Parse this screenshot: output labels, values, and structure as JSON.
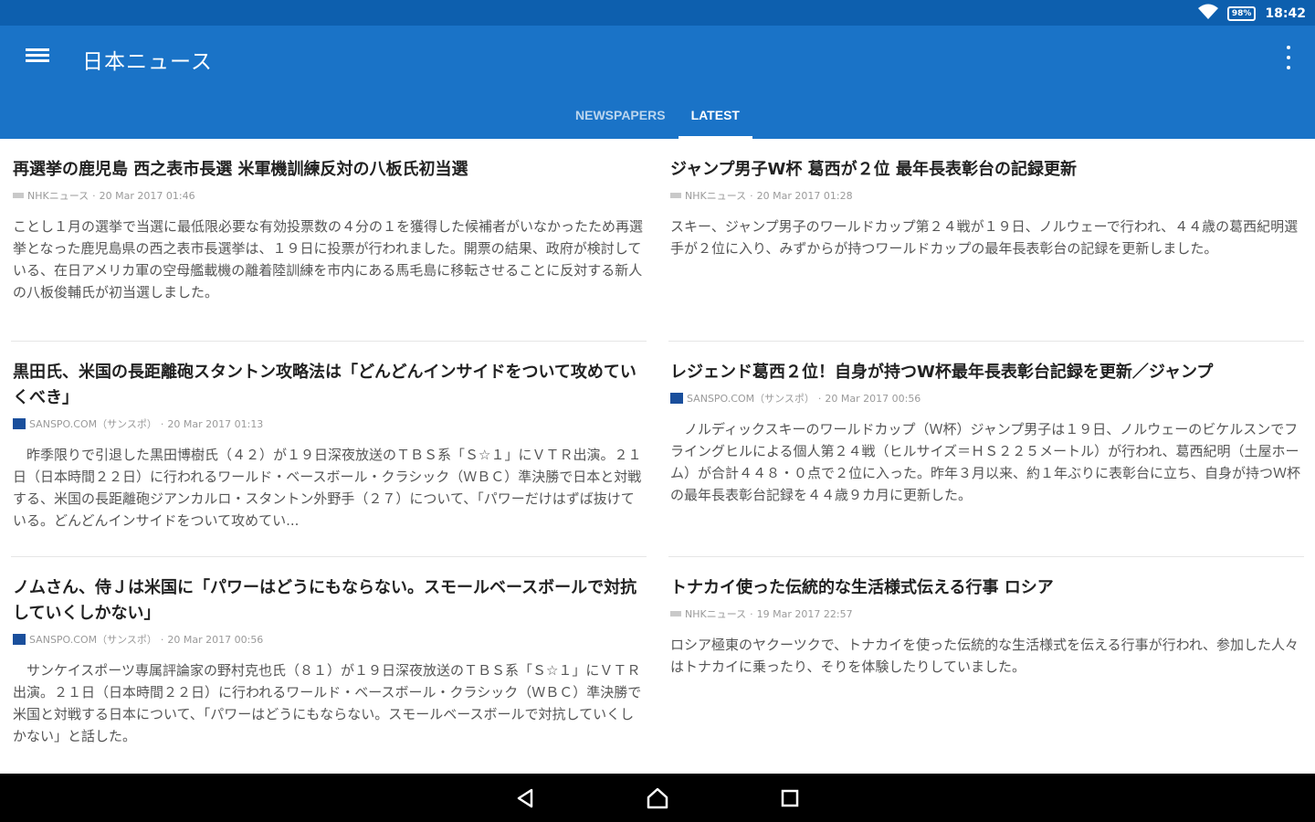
{
  "status_bar": {
    "battery": "98%",
    "time": "18:42"
  },
  "appbar": {
    "title": "日本ニュース"
  },
  "tabs": [
    {
      "label": "NEWSPAPERS",
      "active": false
    },
    {
      "label": "LATEST",
      "active": true
    }
  ],
  "articles": [
    {
      "headline": "再選挙の鹿児島 西之表市長選 米軍機訓練反対の八板氏初当選",
      "source": "NHKニュース",
      "date": "20 Mar 2017 01:46",
      "summary": "ことし１月の選挙で当選に最低限必要な有効投票数の４分の１を獲得した候補者がいなかったため再選挙となった鹿児島県の西之表市長選挙は、１９日に投票が行われました。開票の結果、政府が検討している、在日アメリカ軍の空母艦載機の離着陸訓練を市内にある馬毛島に移転させることに反対する新人の八板俊輔氏が初当選しました。"
    },
    {
      "headline": "ジャンプ男子W杯 葛西が２位 最年長表彰台の記録更新",
      "source": "NHKニュース",
      "date": "20 Mar 2017 01:28",
      "summary": "スキー、ジャンプ男子のワールドカップ第２４戦が１９日、ノルウェーで行われ、４４歳の葛西紀明選手が２位に入り、みずからが持つワールドカップの最年長表彰台の記録を更新しました。"
    },
    {
      "headline": "黒田氏、米国の長距離砲スタントン攻略法は「どんどんインサイドをついて攻めていくべき」",
      "source": "SANSPO.COM（サンスポ）",
      "date": "20 Mar 2017 01:13",
      "summary": "　昨季限りで引退した黒田博樹氏（４２）が１９日深夜放送のＴＢＳ系「Ｓ☆１」にＶＴＲ出演。２１日（日本時間２２日）に行われるワールド・ベースボール・クラシック（ＷＢＣ）準決勝で日本と対戦する、米国の長距離砲ジアンカルロ・スタントン外野手（２７）について、「パワーだけはずば抜けている。どんどんインサイドをついて攻めてい..."
    },
    {
      "headline": "レジェンド葛西２位！自身が持つW杯最年長表彰台記録を更新／ジャンプ",
      "source": "SANSPO.COM（サンスポ）",
      "date": "20 Mar 2017 00:56",
      "summary": "　ノルディックスキーのワールドカップ（Ｗ杯）ジャンプ男子は１９日、ノルウェーのビケルスンでフライングヒルによる個人第２４戦（ヒルサイズ＝ＨＳ２２５メートル）が行われ、葛西紀明（土屋ホーム）が合計４４８・０点で２位に入った。昨年３月以来、約１年ぶりに表彰台に立ち、自身が持つＷ杯の最年長表彰台記録を４４歳９カ月に更新した。"
    },
    {
      "headline": "ノムさん、侍Ｊは米国に「パワーはどうにもならない。スモールベースボールで対抗していくしかない」",
      "source": "SANSPO.COM（サンスポ）",
      "date": "20 Mar 2017 00:56",
      "summary": "　サンケイスポーツ専属評論家の野村克也氏（８１）が１９日深夜放送のＴＢＳ系「Ｓ☆１」にＶＴＲ出演。２１日（日本時間２２日）に行われるワールド・ベースボール・クラシック（ＷＢＣ）準決勝で米国と対戦する日本について、「パワーはどうにもならない。スモールベースボールで対抗していくしかない」と話した。"
    },
    {
      "headline": "トナカイ使った伝統的な生活様式伝える行事 ロシア",
      "source": "NHKニュース",
      "date": "19 Mar 2017 22:57",
      "summary": "ロシア極東のヤクーツクで、トナカイを使った伝統的な生活様式を伝える行事が行われ、参加した人々はトナカイに乗ったり、そりを体験したりしていました。"
    }
  ]
}
